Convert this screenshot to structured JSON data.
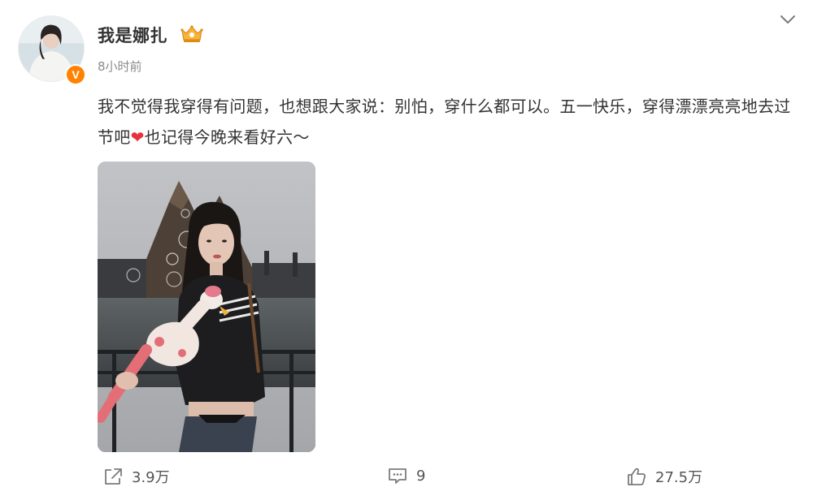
{
  "post": {
    "username": "我是娜扎",
    "timestamp": "8小时前",
    "verified_mark": "V",
    "text_part1": "我不觉得我穿得有问题，也想跟大家说：别怕，穿什么都可以。五一快乐，穿得漂漂亮亮地去过节吧",
    "emoji": "❤",
    "text_part2": "也记得今晚来看好六～"
  },
  "actions": {
    "share_count": "3.9万",
    "comment_count": "9",
    "like_count": "27.5万"
  },
  "icons": {
    "more": "chevron-down-icon",
    "vip": "crown-icon",
    "share": "share-icon",
    "comment": "comment-icon",
    "like": "thumbs-up-icon"
  },
  "colors": {
    "verified": "#ff8200",
    "heart": "#e8323c",
    "text": "#333333",
    "muted": "#8b8b8b"
  }
}
